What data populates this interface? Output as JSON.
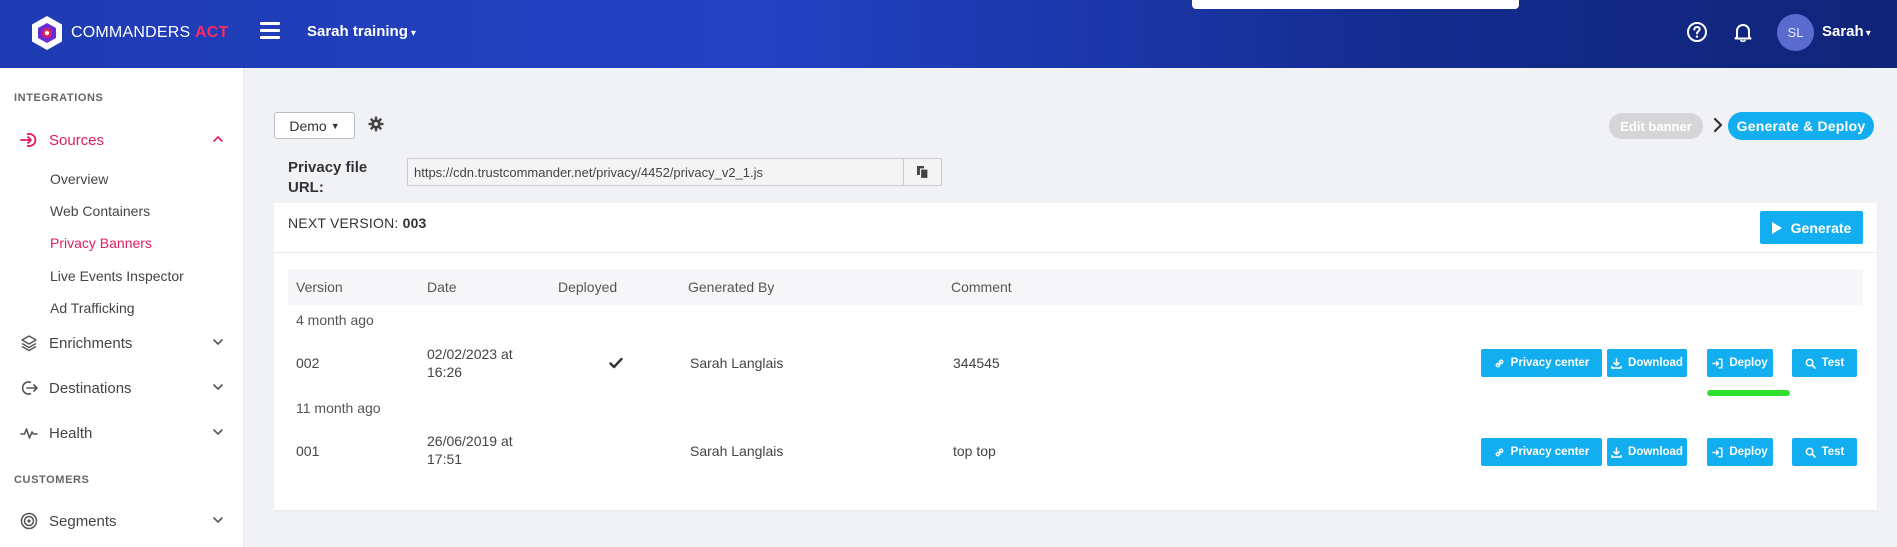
{
  "header": {
    "brand_main": "COMMANDERS",
    "brand_accent": "ACT",
    "account_name": "Sarah training",
    "user_initials": "SL",
    "user_name": "Sarah"
  },
  "sidebar": {
    "section_integrations": "INTEGRATIONS",
    "sources": "Sources",
    "sub_items": [
      "Overview",
      "Web Containers",
      "Privacy Banners",
      "Live Events Inspector",
      "Ad Trafficking"
    ],
    "enrichments": "Enrichments",
    "destinations": "Destinations",
    "health": "Health",
    "section_customers": "CUSTOMERS",
    "segments": "Segments"
  },
  "toolbar": {
    "demo_label": "Demo",
    "edit_banner": "Edit banner",
    "generate_deploy": "Generate & Deploy"
  },
  "privacy_file": {
    "label": "Privacy file URL:",
    "url": "https://cdn.trustcommander.net/privacy/4452/privacy_v2_1.js"
  },
  "panel": {
    "next_version_label": "NEXT VERSION:",
    "next_version_value": "003",
    "generate_label": "Generate"
  },
  "table": {
    "columns": [
      "Version",
      "Date",
      "Deployed",
      "Generated By",
      "Comment"
    ],
    "groups": [
      {
        "label": "4 month ago",
        "rows": [
          {
            "version": "002",
            "date_line1": "02/02/2023 at",
            "date_line2": "16:26",
            "deployed": true,
            "generated_by": "Sarah Langlais",
            "comment": "344545"
          }
        ]
      },
      {
        "label": "11 month ago",
        "rows": [
          {
            "version": "001",
            "date_line1": "26/06/2019 at",
            "date_line2": "17:51",
            "deployed": false,
            "generated_by": "Sarah Langlais",
            "comment": "top top"
          }
        ]
      }
    ],
    "actions": [
      "Privacy center",
      "Download",
      "Deploy",
      "Test"
    ]
  },
  "colors": {
    "accent": "#13aef0",
    "brand_pink": "#e11d5b",
    "header_blue": "#1f3bb3",
    "highlight_green": "#2ee02a"
  }
}
